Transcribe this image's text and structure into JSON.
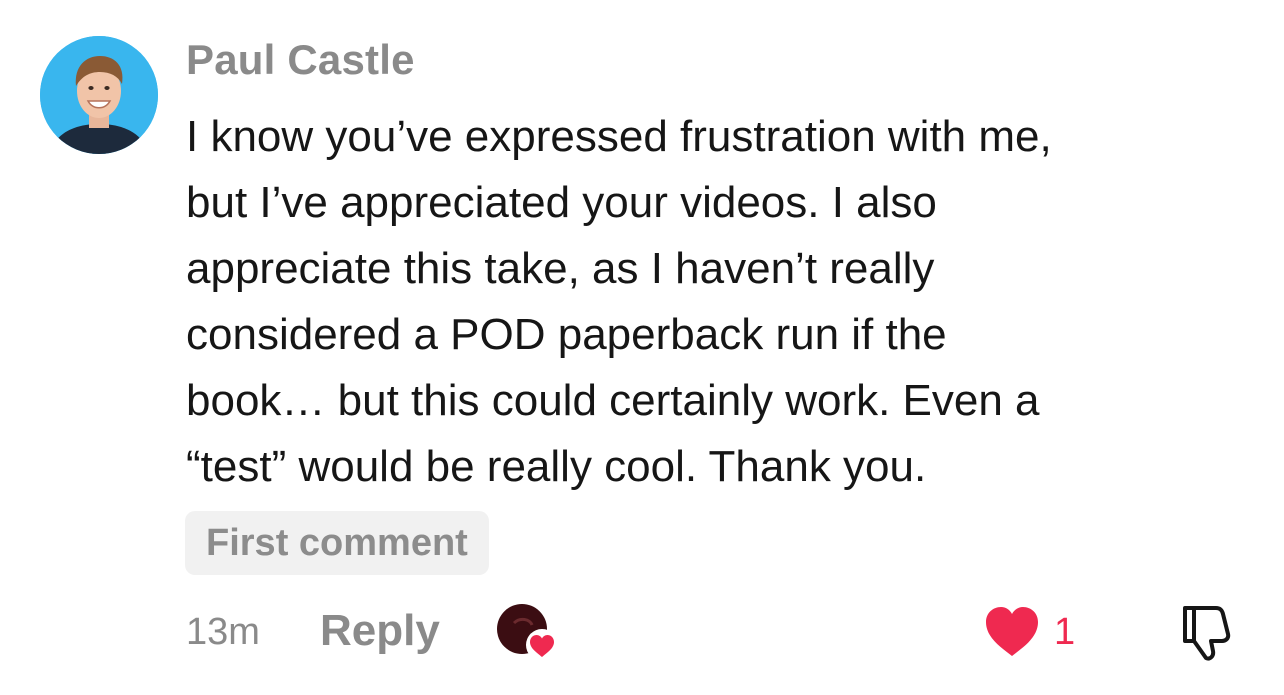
{
  "comment": {
    "author": "Paul Castle",
    "text_lines": [
      "I know you’ve expressed frustration with me,",
      "but I’ve appreciated your videos. I also",
      "appreciate this take, as I haven’t really",
      "considered a POD paperback run if the",
      "book… but this could certainly work. Even a",
      "“test” would be really cool. Thank you."
    ],
    "tag": "First comment",
    "timestamp": "13m",
    "reply_label": "Reply",
    "like_count": "1",
    "liked_by_creator": true,
    "liked": true
  },
  "icons": {
    "avatar": "profile-photo-icon",
    "creator_liked": "creator-avatar-heart-icon",
    "like": "heart-icon",
    "dislike": "thumbs-down-icon"
  },
  "colors": {
    "accent": "#ef2950",
    "muted_text": "#8a8a8a",
    "tag_background": "#f1f1f1",
    "avatar_background": "#39b6ee"
  }
}
